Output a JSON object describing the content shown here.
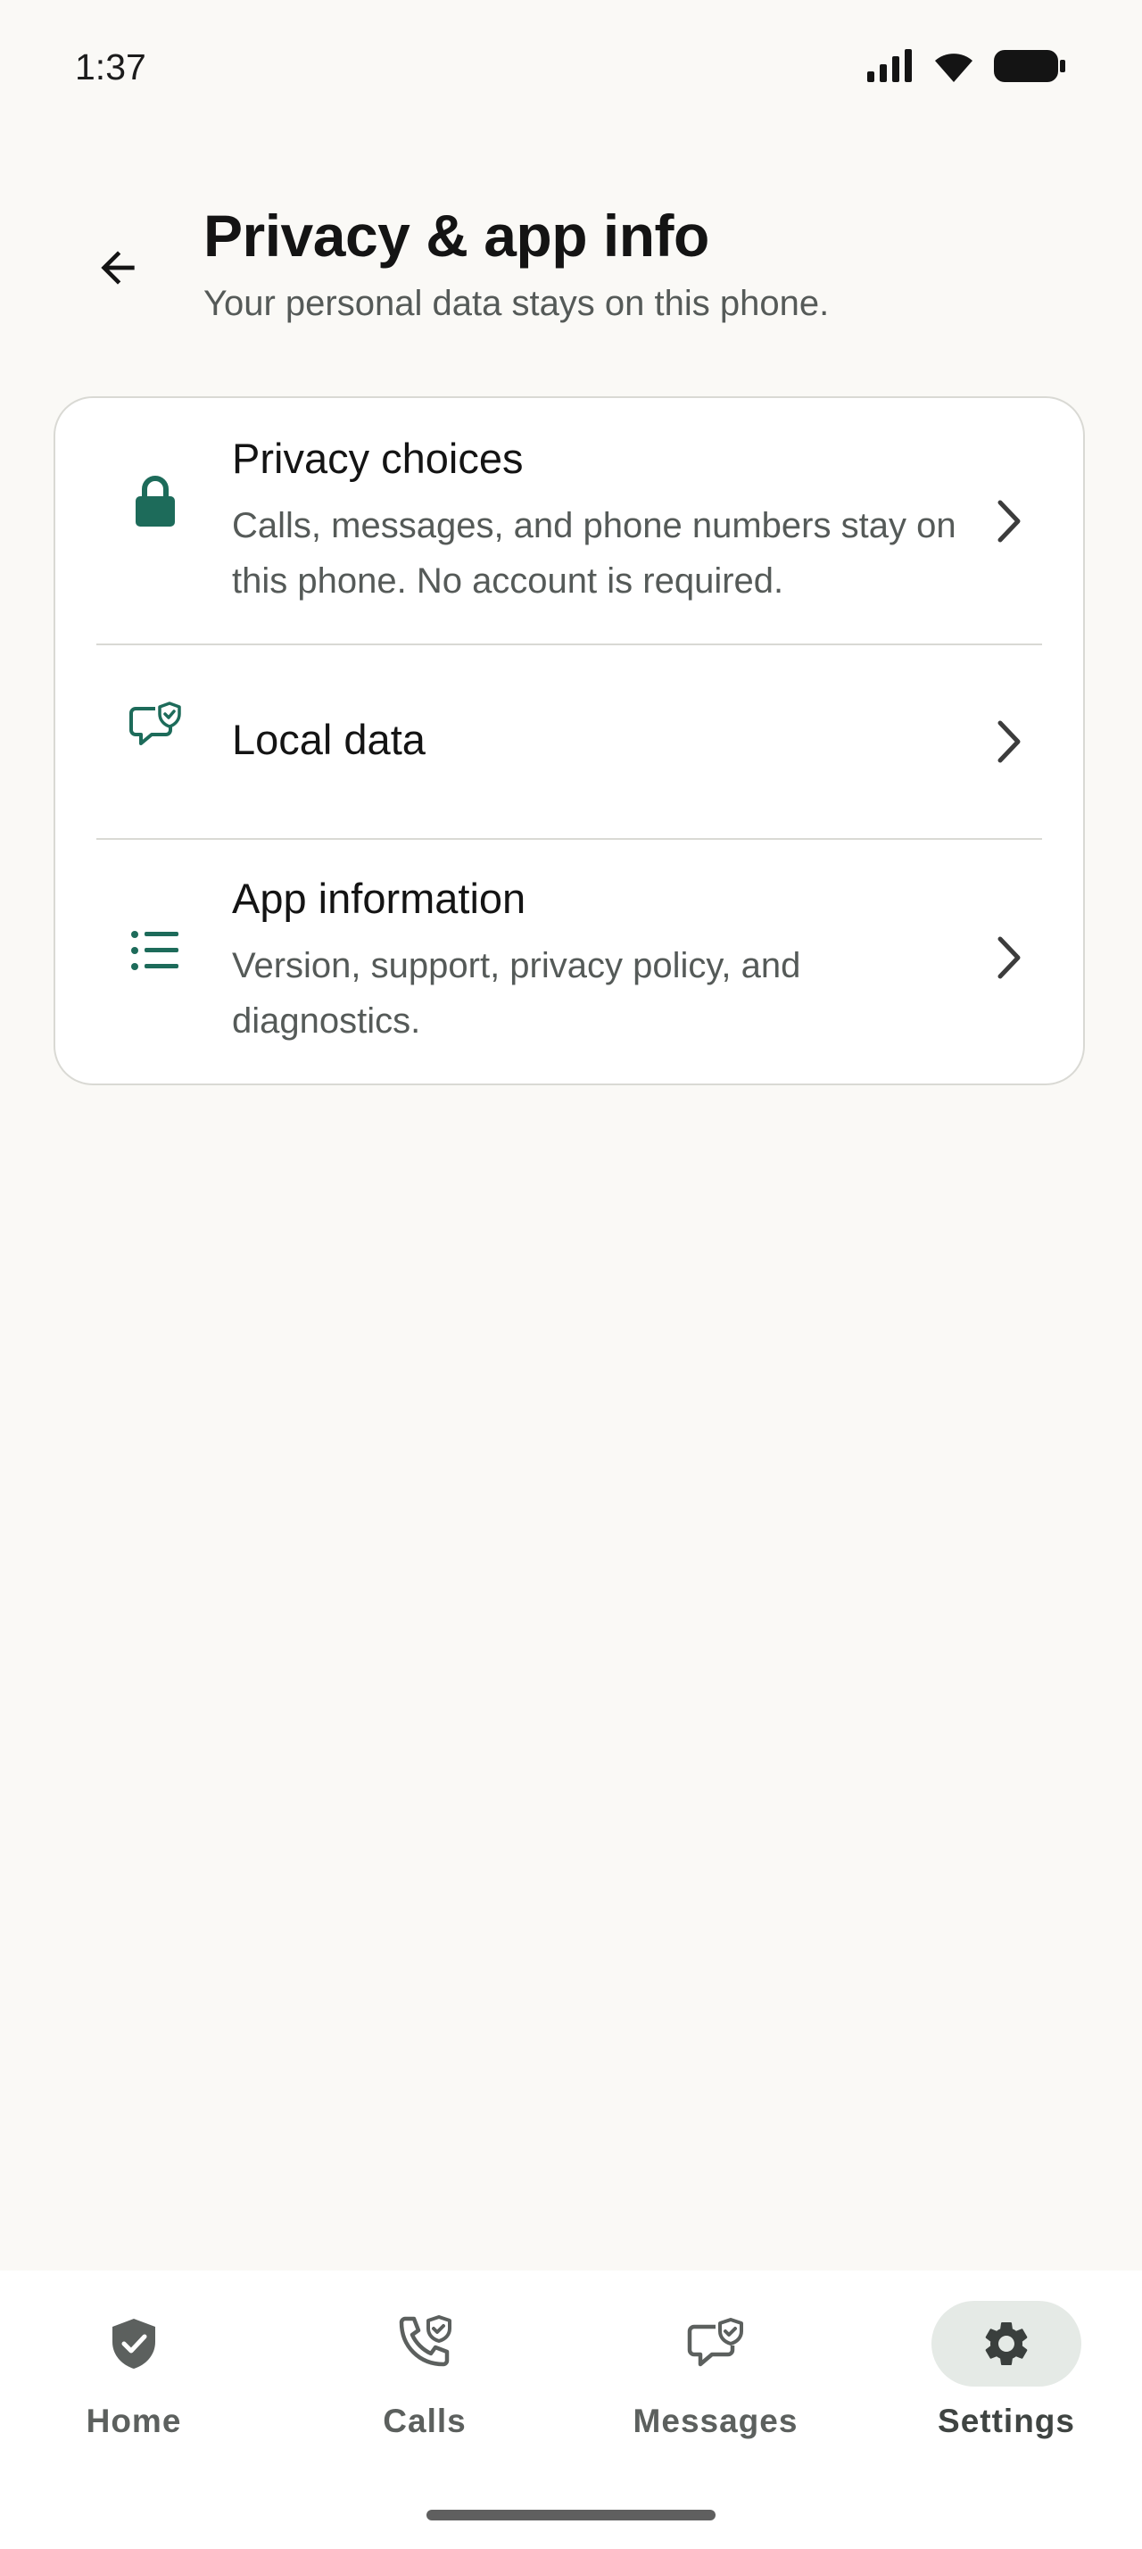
{
  "status_bar": {
    "time": "1:37"
  },
  "header": {
    "title": "Privacy & app info",
    "subtitle": "Your personal data stays on this phone."
  },
  "rows": [
    {
      "title": "Privacy choices",
      "description": "Calls, messages, and phone numbers stay on this phone. No account is required.",
      "icon": "lock-icon"
    },
    {
      "title": "Local data",
      "description": "",
      "icon": "chat-shield-icon"
    },
    {
      "title": "App information",
      "description": "Version, support, privacy policy, and diagnostics.",
      "icon": "list-icon"
    }
  ],
  "bottom_nav": {
    "items": [
      {
        "label": "Home",
        "icon": "shield-check-icon",
        "active": false
      },
      {
        "label": "Calls",
        "icon": "phone-shield-icon",
        "active": false
      },
      {
        "label": "Messages",
        "icon": "chat-shield-icon",
        "active": false
      },
      {
        "label": "Settings",
        "icon": "gear-icon",
        "active": true
      }
    ]
  },
  "colors": {
    "accent": "#1d6b5a",
    "background": "#faf9f6",
    "card_background": "#ffffff",
    "divider": "#d9d9d4",
    "secondary_text": "#555a58",
    "nav_active_pill": "#e5eae6"
  }
}
